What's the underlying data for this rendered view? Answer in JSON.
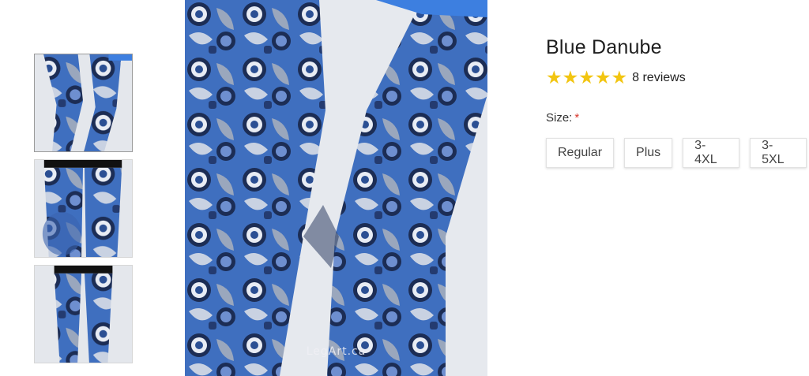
{
  "product": {
    "title": "Blue Danube",
    "rating": 5,
    "star_color": "#f2c511",
    "reviews_label": "8 reviews",
    "watermark": "LegArt.ca"
  },
  "size_selector": {
    "label": "Size:",
    "required_marker": "*",
    "options": [
      "Regular",
      "Plus",
      "3-4XL",
      "3-5XL"
    ]
  },
  "gallery": {
    "thumbnail_count": 3,
    "active_index": 0
  },
  "colors": {
    "pattern_blue": "#3f6fbf",
    "pattern_navy": "#1c2d55",
    "required_red": "#d9352b"
  }
}
